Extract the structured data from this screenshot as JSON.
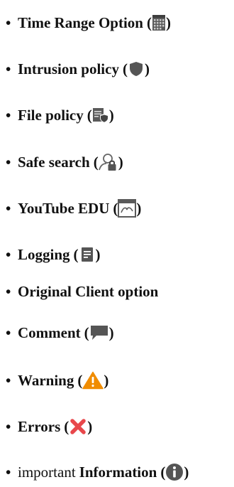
{
  "items": [
    {
      "label": "Time Range Option",
      "open": "(",
      "close": ")",
      "icon": "calendar-icon"
    },
    {
      "label": "Intrusion policy",
      "open": "(",
      "close": ")",
      "icon": "shield-icon"
    },
    {
      "label": "File policy",
      "open": "(",
      "close": ")",
      "icon": "file-shield-icon"
    },
    {
      "label": "Safe search",
      "open": "(",
      "close": ")",
      "icon": "person-lock-icon"
    },
    {
      "label": "YouTube EDU",
      "open": "(",
      "close": ")",
      "icon": "browser-window-icon"
    },
    {
      "label": "Logging",
      "open": "(",
      "close": ")",
      "icon": "log-document-icon"
    },
    {
      "label": "Original Client option"
    },
    {
      "label": "Comment",
      "open": "(",
      "close": ")",
      "icon": "speech-bubble-icon"
    },
    {
      "label": "Warning",
      "open": "(",
      "close": ")",
      "icon": "warning-triangle-icon"
    },
    {
      "label": "Errors",
      "open": "(",
      "close": ")",
      "icon": "error-x-icon"
    },
    {
      "prefix": "important",
      "label": "Information",
      "open": "(",
      "close": ")",
      "icon": "info-icon"
    }
  ],
  "bullet": "•",
  "colors": {
    "text": "#111111",
    "icon_gray": "#555555",
    "warning": "#f08c00",
    "error": "#e8474b"
  }
}
